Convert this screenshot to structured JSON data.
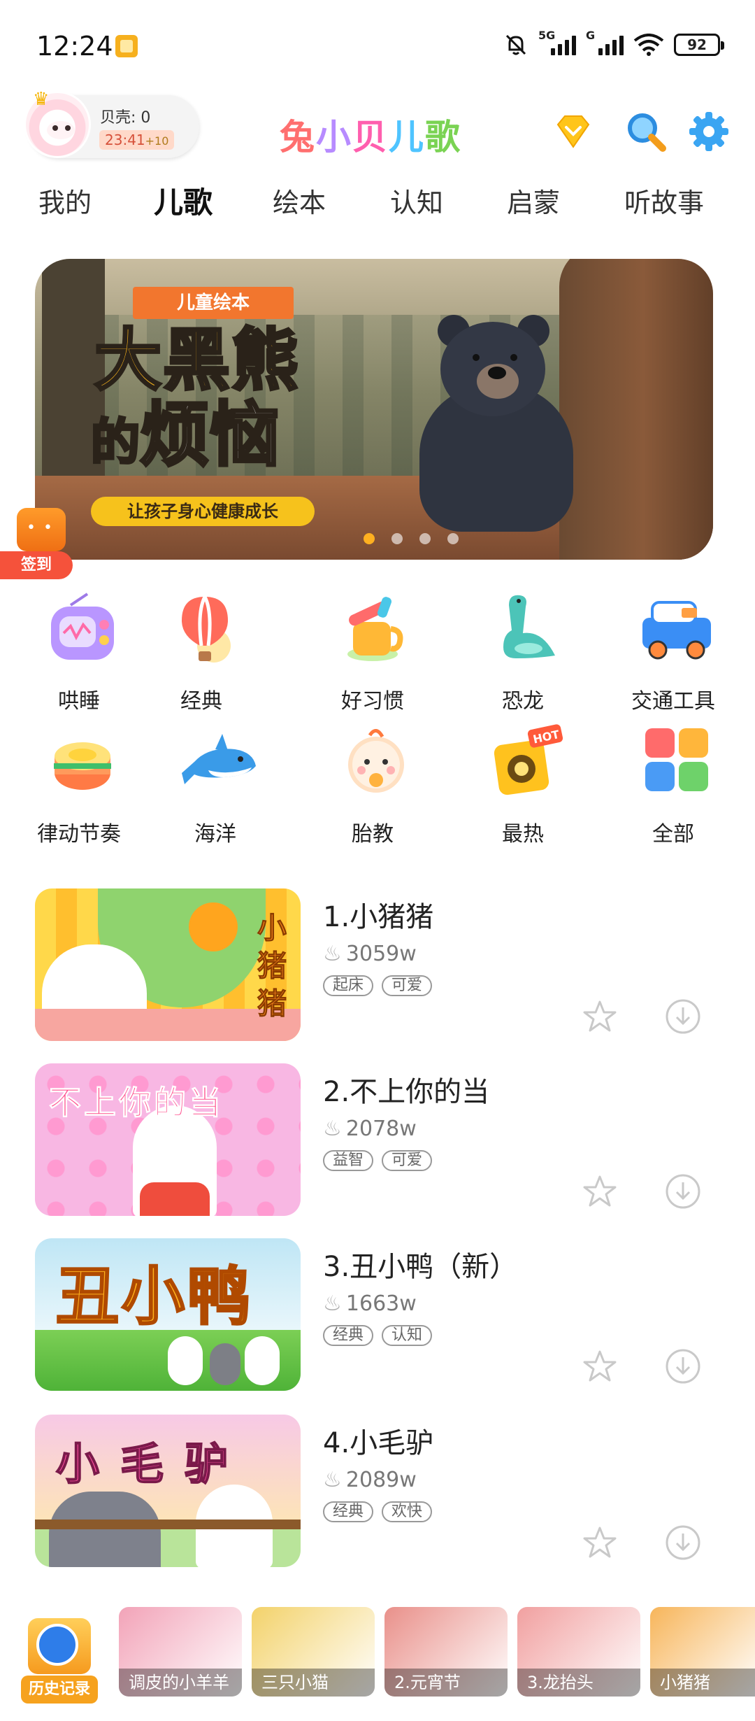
{
  "status_bar": {
    "time": "12:24",
    "battery": "92",
    "signal1": "5G",
    "signal2": "G"
  },
  "header": {
    "shells": "贝壳: 0",
    "timer": "23:41",
    "timer_bonus": "+10",
    "logo": [
      "兔",
      "小",
      "贝",
      "儿",
      "歌"
    ],
    "vip_icon": "diamond-icon",
    "search_icon": "search-icon",
    "settings_icon": "gear-icon"
  },
  "tabs": [
    {
      "label": "我的"
    },
    {
      "label": "儿歌",
      "active": true
    },
    {
      "label": "绘本"
    },
    {
      "label": "认知"
    },
    {
      "label": "启蒙"
    },
    {
      "label": "听故事"
    }
  ],
  "banner": {
    "ribbon": "儿童绘本",
    "title_line1": "大黑熊",
    "title_de": "的",
    "title_line2": "烦恼",
    "subtitle": "让孩子身心健康成长",
    "dots": 4,
    "active_dot": 0
  },
  "checkin": {
    "label": "签到"
  },
  "categories": [
    {
      "name": "哄睡",
      "icon": "radio-icon"
    },
    {
      "name": "经典",
      "icon": "balloon-icon"
    },
    {
      "name": "好习惯",
      "icon": "cup-icon"
    },
    {
      "name": "恐龙",
      "icon": "dinosaur-icon"
    },
    {
      "name": "交通工具",
      "icon": "truck-icon"
    },
    {
      "name": "律动节奏",
      "icon": "drum-icon"
    },
    {
      "name": "海洋",
      "icon": "shark-icon"
    },
    {
      "name": "胎教",
      "icon": "baby-icon"
    },
    {
      "name": "最热",
      "icon": "hot-speaker-icon"
    },
    {
      "name": "全部",
      "icon": "grid-icon"
    }
  ],
  "songs": [
    {
      "title": "1.小猪猪",
      "plays": "3059w",
      "tags": [
        "起床",
        "可爱"
      ],
      "thumb_text": "小猪猪"
    },
    {
      "title": "2.不上你的当",
      "plays": "2078w",
      "tags": [
        "益智",
        "可爱"
      ],
      "thumb_text": "不上你的当"
    },
    {
      "title": "3.丑小鸭（新）",
      "plays": "1663w",
      "tags": [
        "经典",
        "认知"
      ],
      "thumb_text": "丑小鸭"
    },
    {
      "title": "4.小毛驴",
      "plays": "2089w",
      "tags": [
        "经典",
        "欢快"
      ],
      "thumb_text": "小毛驴"
    }
  ],
  "bottom": {
    "history_label": "历史记录",
    "recent": [
      {
        "label": "调皮的小羊羊",
        "color": "#f2a3b8"
      },
      {
        "label": "三只小猫",
        "color": "#f3d26a"
      },
      {
        "label": "2.元宵节",
        "color": "#e9908a"
      },
      {
        "label": "3.龙抬头",
        "color": "#f1a0a0"
      },
      {
        "label": "小猪猪",
        "color": "#f7b55a"
      }
    ]
  }
}
